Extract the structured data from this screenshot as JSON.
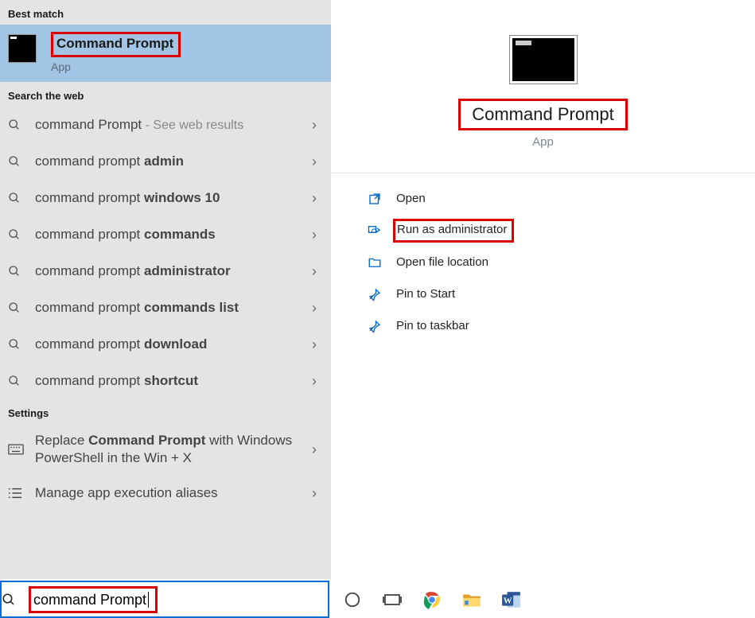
{
  "left": {
    "best_match_header": "Best match",
    "best_match": {
      "title": "Command Prompt",
      "sub": "App"
    },
    "web_header": "Search the web",
    "web_results": [
      {
        "prefix": "command Prompt",
        "bold": "",
        "hint": " - See web results"
      },
      {
        "prefix": "command prompt ",
        "bold": "admin",
        "hint": ""
      },
      {
        "prefix": "command prompt ",
        "bold": "windows 10",
        "hint": ""
      },
      {
        "prefix": "command prompt ",
        "bold": "commands",
        "hint": ""
      },
      {
        "prefix": "command prompt ",
        "bold": "administrator",
        "hint": ""
      },
      {
        "prefix": "command prompt ",
        "bold": "commands list",
        "hint": ""
      },
      {
        "prefix": "command prompt ",
        "bold": "download",
        "hint": ""
      },
      {
        "prefix": "command prompt ",
        "bold": "shortcut",
        "hint": ""
      }
    ],
    "settings_header": "Settings",
    "settings": [
      {
        "label_html": "Replace <b>Command Prompt</b> with Windows PowerShell in the Win + X",
        "icon": "keyboard"
      },
      {
        "label_html": "Manage app execution aliases",
        "icon": "list"
      }
    ]
  },
  "right": {
    "title": "Command Prompt",
    "sub": "App",
    "actions": [
      {
        "label": "Open",
        "icon": "open"
      },
      {
        "label": "Run as administrator",
        "icon": "admin",
        "highlighted": true
      },
      {
        "label": "Open file location",
        "icon": "folder"
      },
      {
        "label": "Pin to Start",
        "icon": "pin"
      },
      {
        "label": "Pin to taskbar",
        "icon": "pin"
      }
    ]
  },
  "search": {
    "value": "command Prompt"
  }
}
